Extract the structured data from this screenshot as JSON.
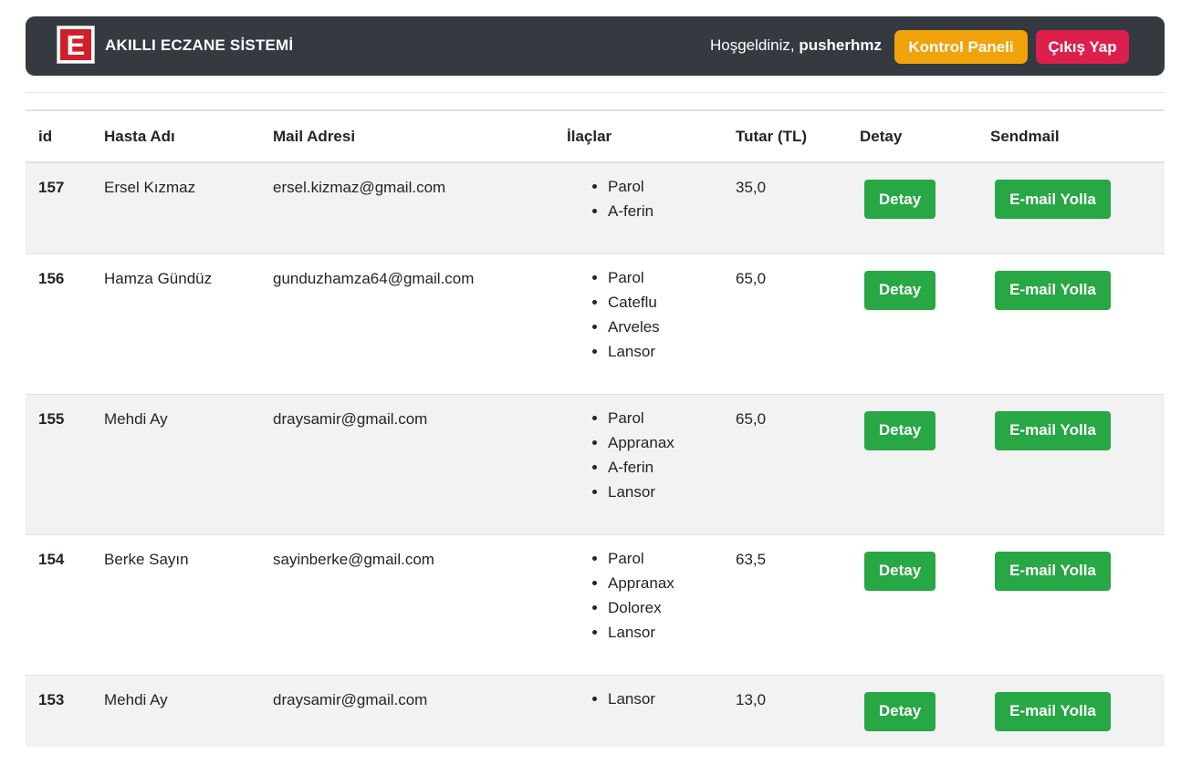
{
  "header": {
    "logo_letter": "E",
    "brand": "AKILLI ECZANE SİSTEMİ",
    "welcome_prefix": "Hoşgeldiniz,",
    "username": "pusherhmz",
    "control_panel_label": "Kontrol Paneli",
    "logout_label": "Çıkış Yap"
  },
  "table": {
    "columns": [
      "id",
      "Hasta Adı",
      "Mail Adresi",
      "İlaçlar",
      "Tutar (TL)",
      "Detay",
      "Sendmail"
    ],
    "rows": [
      {
        "id": "157",
        "name": "Ersel Kızmaz",
        "email": "ersel.kizmaz@gmail.com",
        "meds": [
          "Parol",
          "A-ferin"
        ],
        "total": "35,0",
        "detail_label": "Detay",
        "mail_label": "E-mail Yolla"
      },
      {
        "id": "156",
        "name": "Hamza Gündüz",
        "email": "gunduzhamza64@gmail.com",
        "meds": [
          "Parol",
          "Cateflu",
          "Arveles",
          "Lansor"
        ],
        "total": "65,0",
        "detail_label": "Detay",
        "mail_label": "E-mail Yolla"
      },
      {
        "id": "155",
        "name": "Mehdi Ay",
        "email": "draysamir@gmail.com",
        "meds": [
          "Parol",
          "Appranax",
          "A-ferin",
          "Lansor"
        ],
        "total": "65,0",
        "detail_label": "Detay",
        "mail_label": "E-mail Yolla"
      },
      {
        "id": "154",
        "name": "Berke Sayın",
        "email": "sayinberke@gmail.com",
        "meds": [
          "Parol",
          "Appranax",
          "Dolorex",
          "Lansor"
        ],
        "total": "63,5",
        "detail_label": "Detay",
        "mail_label": "E-mail Yolla"
      },
      {
        "id": "153",
        "name": "Mehdi Ay",
        "email": "draysamir@gmail.com",
        "meds": [
          "Lansor"
        ],
        "total": "13,0",
        "detail_label": "Detay",
        "mail_label": "E-mail Yolla"
      }
    ]
  },
  "colors": {
    "navbar_bg": "#343a40",
    "warning": "#f0a30a",
    "danger": "#dc1f4b",
    "success": "#28a745",
    "logo_red": "#d11f2a",
    "stripe": "#f2f2f2"
  }
}
